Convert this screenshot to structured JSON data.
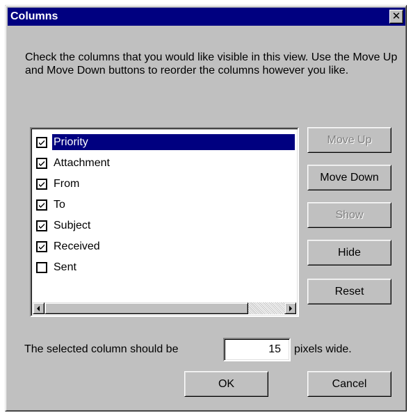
{
  "dialog": {
    "title": "Columns",
    "close_label": "✕",
    "description": "Check the columns that you would like visible in this view. Use the Move Up and Move Down buttons to reorder the columns however you like."
  },
  "columns": [
    {
      "label": "Priority",
      "checked": true,
      "selected": true
    },
    {
      "label": "Attachment",
      "checked": true,
      "selected": false
    },
    {
      "label": "From",
      "checked": true,
      "selected": false
    },
    {
      "label": "To",
      "checked": true,
      "selected": false
    },
    {
      "label": "Subject",
      "checked": true,
      "selected": false
    },
    {
      "label": "Received",
      "checked": true,
      "selected": false
    },
    {
      "label": "Sent",
      "checked": false,
      "selected": false
    }
  ],
  "buttons": {
    "move_up": {
      "label": "Move Up",
      "enabled": false
    },
    "move_down": {
      "label": "Move Down",
      "enabled": true
    },
    "show": {
      "label": "Show",
      "enabled": false
    },
    "hide": {
      "label": "Hide",
      "enabled": true
    },
    "reset": {
      "label": "Reset",
      "enabled": true
    },
    "ok": {
      "label": "OK",
      "enabled": true
    },
    "cancel": {
      "label": "Cancel",
      "enabled": true
    }
  },
  "width_setting": {
    "prefix": "The selected column should be",
    "value": "15",
    "suffix": "pixels wide."
  },
  "colors": {
    "titlebar": "#000080",
    "face": "#c0c0c0",
    "selection": "#000080"
  }
}
